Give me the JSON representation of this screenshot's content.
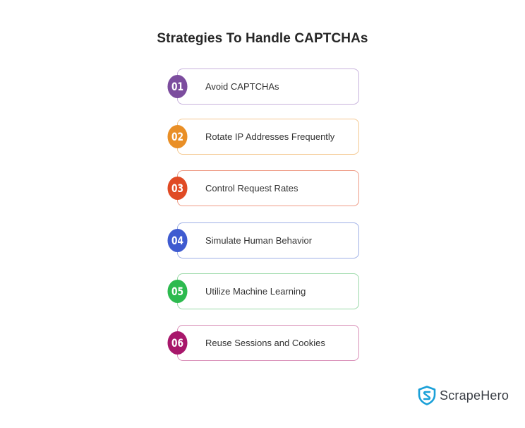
{
  "title": "Strategies To Handle CAPTCHAs",
  "strategies": [
    {
      "number": "01",
      "label": "Avoid CAPTCHAs",
      "color": "#7c4d9e",
      "border": "#c7b2dc"
    },
    {
      "number": "02",
      "label": "Rotate IP Addresses Frequently",
      "color": "#e98f26",
      "border": "#f4c890"
    },
    {
      "number": "03",
      "label": "Control Request Rates",
      "color": "#e04a24",
      "border": "#ef9c86"
    },
    {
      "number": "04",
      "label": "Simulate Human Behavior",
      "color": "#3f5bd0",
      "border": "#9fb0e6"
    },
    {
      "number": "05",
      "label": "Utilize Machine Learning",
      "color": "#2dba4f",
      "border": "#9ad9a8"
    },
    {
      "number": "06",
      "label": "Reuse Sessions and Cookies",
      "color": "#a8176b",
      "border": "#d98fb8"
    }
  ],
  "logo": {
    "brand": "ScrapeHero",
    "icon": "shield-s-icon",
    "color": "#1aa0d8"
  }
}
